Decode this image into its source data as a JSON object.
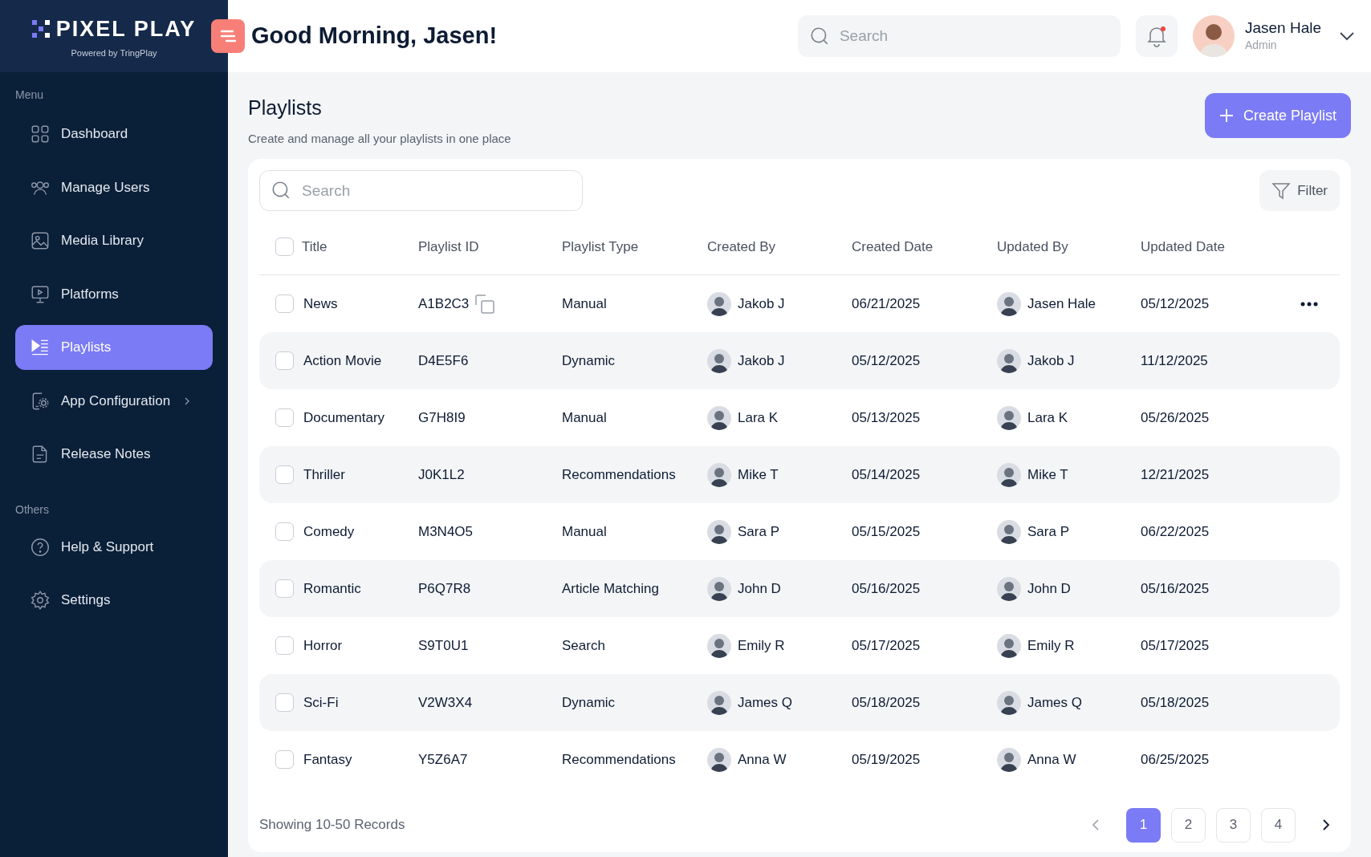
{
  "brand": {
    "name": "PIXEL PLAY",
    "tagline": "Powered by TringPlay"
  },
  "greeting": "Good Morning, Jasen!",
  "header_search": {
    "placeholder": "Search"
  },
  "notifications": {
    "unread": true
  },
  "user": {
    "name": "Jasen Hale",
    "role": "Admin"
  },
  "sidebar": {
    "sections": [
      {
        "label": "Menu",
        "items": [
          {
            "label": "Dashboard",
            "selected": false,
            "has_submenu": false
          },
          {
            "label": "Manage Users",
            "selected": false,
            "has_submenu": false
          },
          {
            "label": "Media Library",
            "selected": false,
            "has_submenu": false
          },
          {
            "label": "Platforms",
            "selected": false,
            "has_submenu": false
          },
          {
            "label": "Playlists",
            "selected": true,
            "has_submenu": false
          },
          {
            "label": "App Configuration",
            "selected": false,
            "has_submenu": true
          },
          {
            "label": "Release Notes",
            "selected": false,
            "has_submenu": false
          }
        ]
      },
      {
        "label": "Others",
        "items": [
          {
            "label": "Help & Support",
            "selected": false,
            "has_submenu": false
          },
          {
            "label": "Settings",
            "selected": false,
            "has_submenu": false
          }
        ]
      }
    ]
  },
  "page": {
    "title": "Playlists",
    "subtitle": "Create and manage all your playlists in one place",
    "create_button": "Create Playlist"
  },
  "table": {
    "search": {
      "placeholder": "Search"
    },
    "filter_button": "Filter",
    "select_all_checked": false,
    "columns": [
      "Title",
      "Playlist ID",
      "Playlist Type",
      "Created By",
      "Created Date",
      "Updated By",
      "Updated Date"
    ],
    "rows": [
      {
        "checked": false,
        "hovered": true,
        "title": "News",
        "id": "A1B2C3",
        "type": "Manual",
        "created_by": "Jakob J",
        "created_date": "06/21/2025",
        "updated_by": "Jasen Hale",
        "updated_date": "05/12/2025"
      },
      {
        "checked": false,
        "hovered": false,
        "title": "Action Movie",
        "id": "D4E5F6",
        "type": "Dynamic",
        "created_by": "Jakob J",
        "created_date": "05/12/2025",
        "updated_by": "Jakob J",
        "updated_date": "11/12/2025"
      },
      {
        "checked": false,
        "hovered": false,
        "title": "Documentary",
        "id": "G7H8I9",
        "type": "Manual",
        "created_by": "Lara K",
        "created_date": "05/13/2025",
        "updated_by": "Lara K",
        "updated_date": "05/26/2025"
      },
      {
        "checked": false,
        "hovered": false,
        "title": "Thriller",
        "id": "J0K1L2",
        "type": "Recommendations",
        "created_by": "Mike T",
        "created_date": "05/14/2025",
        "updated_by": "Mike T",
        "updated_date": "12/21/2025"
      },
      {
        "checked": false,
        "hovered": false,
        "title": "Comedy",
        "id": "M3N4O5",
        "type": "Manual",
        "created_by": "Sara P",
        "created_date": "05/15/2025",
        "updated_by": "Sara P",
        "updated_date": "06/22/2025"
      },
      {
        "checked": false,
        "hovered": false,
        "title": "Romantic",
        "id": "P6Q7R8",
        "type": "Article Matching",
        "created_by": "John D",
        "created_date": "05/16/2025",
        "updated_by": "John D",
        "updated_date": "05/16/2025"
      },
      {
        "checked": false,
        "hovered": false,
        "title": "Horror",
        "id": "S9T0U1",
        "type": "Search",
        "created_by": "Emily R",
        "created_date": "05/17/2025",
        "updated_by": "Emily R",
        "updated_date": "05/17/2025"
      },
      {
        "checked": false,
        "hovered": false,
        "title": "Sci-Fi",
        "id": "V2W3X4",
        "type": "Dynamic",
        "created_by": "James Q",
        "created_date": "05/18/2025",
        "updated_by": "James Q",
        "updated_date": "05/18/2025"
      },
      {
        "checked": false,
        "hovered": false,
        "title": "Fantasy",
        "id": "Y5Z6A7",
        "type": "Recommendations",
        "created_by": "Anna W",
        "created_date": "05/19/2025",
        "updated_by": "Anna W",
        "updated_date": "06/25/2025"
      }
    ]
  },
  "footer": {
    "records": "Showing 10-50 Records",
    "pages": [
      {
        "label": "1",
        "selected": true
      },
      {
        "label": "2",
        "selected": false
      },
      {
        "label": "3",
        "selected": false
      },
      {
        "label": "4",
        "selected": false
      }
    ]
  }
}
